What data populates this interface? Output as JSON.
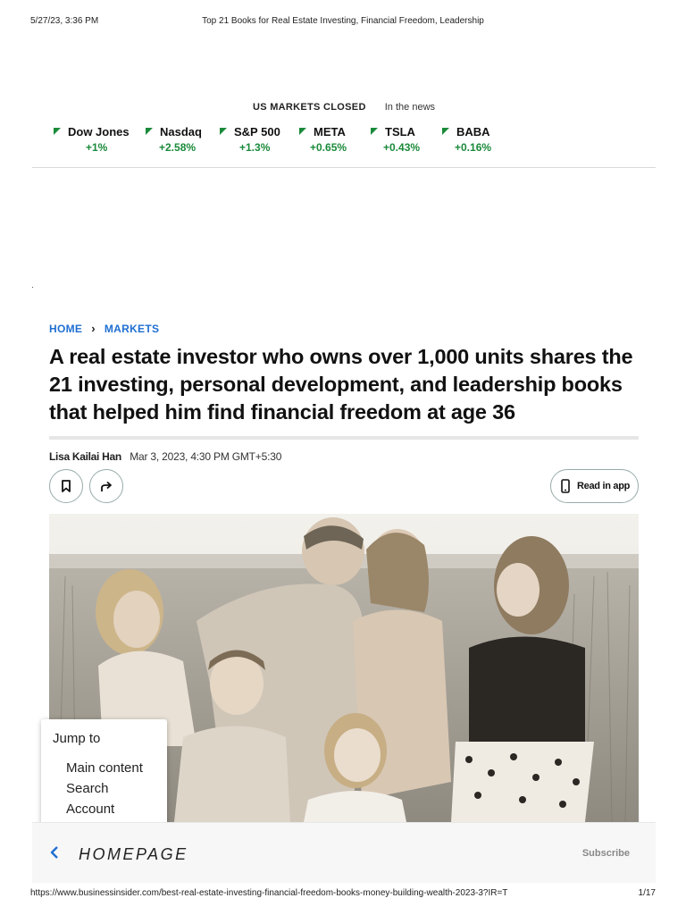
{
  "print_header": {
    "datetime": "5/27/23, 3:36 PM",
    "title": "Top 21 Books for Real Estate Investing, Financial Freedom, Leadership"
  },
  "markets": {
    "status": "US MARKETS CLOSED",
    "news_label": "In the news",
    "up_color": "#1a8a3a",
    "tickers": [
      {
        "name": "Dow Jones",
        "change": "+1%"
      },
      {
        "name": "Nasdaq",
        "change": "+2.58%"
      },
      {
        "name": "S&P 500",
        "change": "+1.3%"
      },
      {
        "name": "META",
        "change": "+0.65%"
      },
      {
        "name": "TSLA",
        "change": "+0.43%"
      },
      {
        "name": "BABA",
        "change": "+0.16%"
      }
    ]
  },
  "breadcrumb": {
    "home": "HOME",
    "section": "MARKETS",
    "link_color": "#1f6fd1"
  },
  "article": {
    "headline": "A real estate investor who owns over 1,000 units shares the 21 investing, personal development, and leadership books that helped him find financial freedom at age 36",
    "author": "Lisa Kailai Han",
    "date": "Mar 3, 2023, 4:30 PM GMT+5:30",
    "read_in_app": "Read in app",
    "icons": [
      "bookmark-icon",
      "share-icon",
      "phone-icon"
    ]
  },
  "jump_menu": {
    "title": "Jump to",
    "items": [
      "Main content",
      "Search",
      "Account"
    ]
  },
  "bottom_bar": {
    "homepage": "HOMEPAGE",
    "subscribe": "Subscribe"
  },
  "print_footer": {
    "url": "https://www.businessinsider.com/best-real-estate-investing-financial-freedom-books-money-building-wealth-2023-3?IR=T",
    "page": "1/17"
  }
}
